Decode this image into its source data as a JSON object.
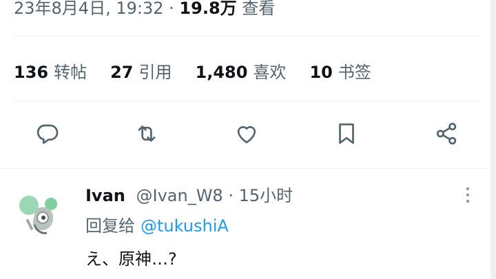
{
  "tweet": {
    "timestamp": "23年8月4日, 19:32",
    "separator": "·",
    "views_count": "19.8万",
    "views_label": "查看"
  },
  "stats": [
    {
      "count": "136",
      "label": "转帖"
    },
    {
      "count": "27",
      "label": "引用"
    },
    {
      "count": "1,480",
      "label": "喜欢"
    },
    {
      "count": "10",
      "label": "书签"
    }
  ],
  "actions": [
    "reply-icon",
    "retweet-icon",
    "like-icon",
    "bookmark-icon",
    "share-icon"
  ],
  "reply": {
    "display_name": "Ivan",
    "handle": "@Ivan_W8",
    "separator": "·",
    "time": "15小时",
    "reply_prefix": "回复给",
    "reply_to_handle": "@tukushiA",
    "text": "え、原神…?"
  },
  "colors": {
    "icon": "#536471",
    "link": "#1d9bf0",
    "text": "#0f1419",
    "divider": "#eff3f4"
  }
}
